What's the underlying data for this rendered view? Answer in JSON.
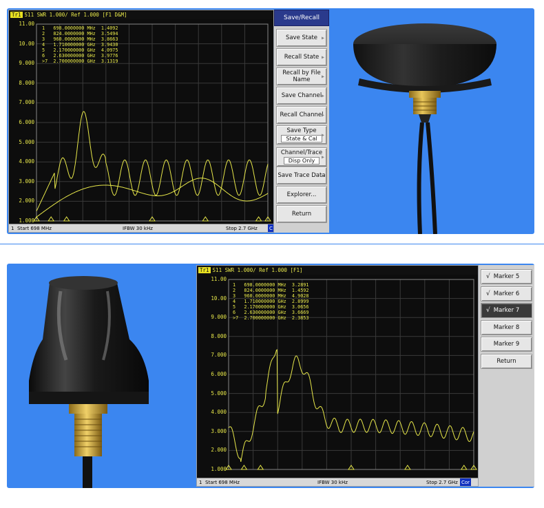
{
  "screen1": {
    "title": "S11  SWR 1.000/ Ref 1.000  [F1 D&M]",
    "trace_badge": "Tr1",
    "y_ticks": [
      "11.00",
      "10.00",
      "9.000",
      "8.000",
      "7.000",
      "6.000",
      "5.000",
      "4.000",
      "3.000",
      "2.000",
      "1.000"
    ],
    "markers": [
      "1   698.0000000 MHz  1.4092",
      "2   824.0000000 MHz  3.5494",
      "3   960.0000000 MHz  3.8663",
      "4   1.710000000 GHz  3.9430",
      "5   2.170000000 GHz  4.0975",
      "6   2.630000000 GHz  3.9776",
      ">7  2.700000000 GHz  3.1319"
    ],
    "status": {
      "channel": "1",
      "start": "Start 698 MHz",
      "ifbw": "IFBW 30 kHz",
      "stop": "Stop 2.7 GHz",
      "cor": "C"
    },
    "softkeys": {
      "title": "Save/Recall",
      "items": [
        {
          "label": "Save State",
          "sub": ""
        },
        {
          "label": "Recall State",
          "sub": ""
        },
        {
          "label": "Recall by File Name",
          "sub": ""
        },
        {
          "label": "Save Channel",
          "sub": ""
        },
        {
          "label": "Recall Channel",
          "sub": ""
        },
        {
          "label": "Save Type",
          "sub": "State & Cal"
        },
        {
          "label": "Channel/Trace",
          "sub": "Disp Only"
        },
        {
          "label": "Save Trace Data",
          "sub": ""
        },
        {
          "label": "Explorer...",
          "sub": ""
        },
        {
          "label": "Return",
          "sub": ""
        }
      ]
    }
  },
  "screen2": {
    "title": "S11  SWR 1.000/ Ref 1.000  [F1]",
    "trace_badge": "Tr1",
    "y_ticks": [
      "11.00",
      "10.00",
      "9.000",
      "8.000",
      "7.000",
      "6.000",
      "5.000",
      "4.000",
      "3.000",
      "2.000",
      "1.000"
    ],
    "markers": [
      "1   698.0000000 MHz  3.2891",
      "2   824.0000000 MHz  1.4592",
      "3   960.0000000 MHz  4.9028",
      "4   1.710000000 GHz  2.8999",
      "5   2.170000000 GHz  3.0656",
      "6   2.630000000 GHz  3.6669",
      ">7  2.700000000 GHz  2.3853"
    ],
    "status": {
      "channel": "1",
      "start": "Start 698 MHz",
      "ifbw": "IFBW 30 kHz",
      "stop": "Stop 2.7 GHz",
      "cor": "Cor"
    },
    "softkeys": {
      "items": [
        {
          "label": "Marker 5",
          "checked": "√"
        },
        {
          "label": "Marker 6",
          "checked": "√"
        },
        {
          "label": "Marker 7",
          "checked": "√"
        },
        {
          "label": "Marker 8",
          "checked": ""
        },
        {
          "label": "Marker 9",
          "checked": ""
        },
        {
          "label": "Return",
          "checked": ""
        }
      ]
    }
  },
  "colors": {
    "panel_bg": "#3b86f0",
    "trace_yellow": "#e8e84a",
    "softkey_title": "#2a3a8c"
  },
  "icons": [
    "submenu-arrow-icon",
    "checkmark-icon",
    "marker-triangle-icon"
  ]
}
